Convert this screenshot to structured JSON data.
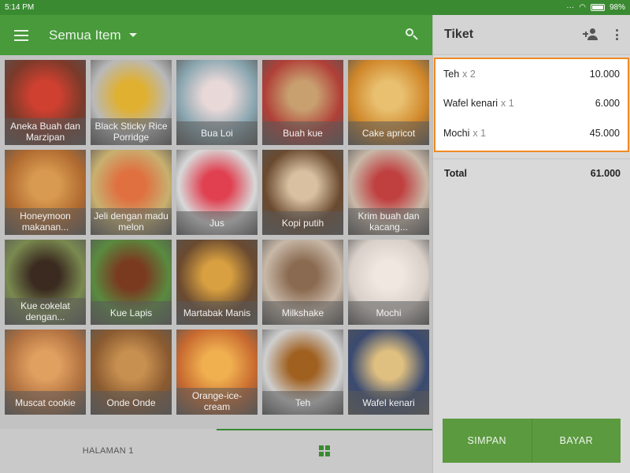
{
  "status": {
    "time": "5:14 PM",
    "battery": "98%"
  },
  "appbar": {
    "title": "Semua Item"
  },
  "items": [
    {
      "label": "Aneka Buah dan Marzipan",
      "bg": "#7a3a2a",
      "accent": "#d04030"
    },
    {
      "label": "Black Sticky Rice Porridge",
      "bg": "#b9b9b9",
      "accent": "#e0b030"
    },
    {
      "label": "Bua Loi",
      "bg": "#8aa6b0",
      "accent": "#e8d8d8"
    },
    {
      "label": "Buah kue",
      "bg": "#b04038",
      "accent": "#c8a070"
    },
    {
      "label": "Cake apricot",
      "bg": "#d0872a",
      "accent": "#e8c070"
    },
    {
      "label": "Honeymoon makanan...",
      "bg": "#b06a30",
      "accent": "#d89a50"
    },
    {
      "label": "Jeli dengan madu melon",
      "bg": "#c8b070",
      "accent": "#e07040"
    },
    {
      "label": "Jus",
      "bg": "#d8d8d8",
      "accent": "#e04050"
    },
    {
      "label": "Kopi putih",
      "bg": "#6a4a30",
      "accent": "#d8c0a0"
    },
    {
      "label": "Krim buah dan kacang...",
      "bg": "#c8b8a8",
      "accent": "#c04040"
    },
    {
      "label": "Kue cokelat dengan...",
      "bg": "#7a8a50",
      "accent": "#3a2a20"
    },
    {
      "label": "Kue Lapis",
      "bg": "#5a8a40",
      "accent": "#7a3a20"
    },
    {
      "label": "Martabak Manis",
      "bg": "#6a4a30",
      "accent": "#d8a040"
    },
    {
      "label": "Milkshake",
      "bg": "#c8b8a8",
      "accent": "#8a6a50"
    },
    {
      "label": "Mochi",
      "bg": "#d8cfc8",
      "accent": "#f0e8e0"
    },
    {
      "label": "Muscat cookie",
      "bg": "#b07040",
      "accent": "#e0a060"
    },
    {
      "label": "Onde Onde",
      "bg": "#8a5a30",
      "accent": "#c89050"
    },
    {
      "label": "Orange-ice-cream",
      "bg": "#c86a30",
      "accent": "#f0b050"
    },
    {
      "label": "Teh",
      "bg": "#cfcfcf",
      "accent": "#a06020"
    },
    {
      "label": "Wafel kenari",
      "bg": "#3a4a70",
      "accent": "#e0c080"
    }
  ],
  "bottom": {
    "page_label": "HALAMAN 1"
  },
  "ticket": {
    "title": "Tiket",
    "lines": [
      {
        "name": "Teh",
        "qty": "x 2",
        "price": "10.000"
      },
      {
        "name": "Wafel kenari",
        "qty": "x 1",
        "price": "6.000"
      },
      {
        "name": "Mochi",
        "qty": "x 1",
        "price": "45.000"
      }
    ],
    "total_label": "Total",
    "total_value": "61.000",
    "save_label": "SIMPAN",
    "pay_label": "BAYAR"
  },
  "colors": {
    "brand": "#489a3b",
    "highlight": "#f08a24",
    "button": "#5b9a3f"
  }
}
